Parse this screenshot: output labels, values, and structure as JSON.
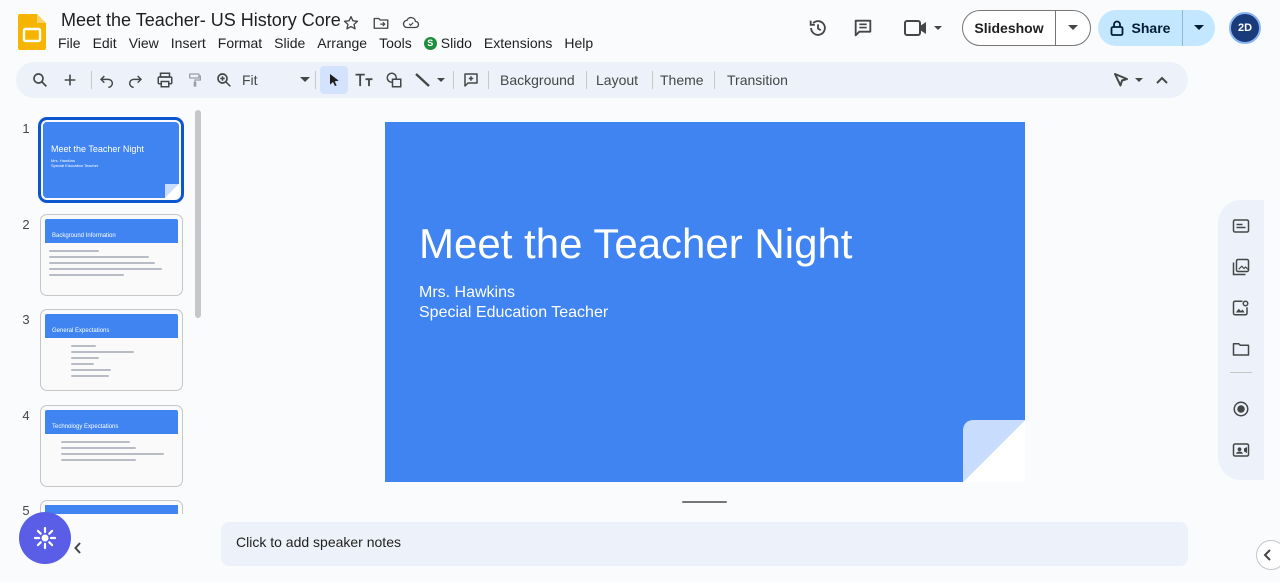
{
  "app": {
    "doc_title": "Meet the Teacher- US History Core"
  },
  "menu": [
    "File",
    "Edit",
    "View",
    "Insert",
    "Format",
    "Slide",
    "Arrange",
    "Tools",
    "Slido",
    "Extensions",
    "Help"
  ],
  "slido_badge": "S",
  "header": {
    "slideshow_label": "Slideshow",
    "share_label": "Share",
    "avatar_text": "2D"
  },
  "toolbar": {
    "zoom_label": "Fit",
    "background_label": "Background",
    "layout_label": "Layout",
    "theme_label": "Theme",
    "transition_label": "Transition"
  },
  "filmstrip": {
    "numbers": [
      "1",
      "2",
      "3",
      "4",
      "5"
    ],
    "slides": [
      {
        "title": "Meet the Teacher Night",
        "sub1": "Mrs. Hawkins",
        "sub2": "Special Education Teacher"
      },
      {
        "title": "Background Information"
      },
      {
        "title": "General Expectations"
      },
      {
        "title": "Technology Expectations"
      }
    ]
  },
  "slide": {
    "title": "Meet the Teacher Night",
    "subtitle_line1": "Mrs. Hawkins",
    "subtitle_line2": "Special Education Teacher"
  },
  "notes": {
    "placeholder": "Click to add speaker notes"
  },
  "colors": {
    "accent": "#0b57d0",
    "slide_bg": "#3f84f1",
    "share_bg": "#c2e7ff",
    "toolbar_bg": "#edf2fa"
  },
  "icons": [
    "star-icon",
    "move-to-folder-icon",
    "cloud-saved-icon",
    "history-icon",
    "comment-icon",
    "video-call-icon",
    "lock-icon",
    "search-icon",
    "plus-icon",
    "undo-icon",
    "redo-icon",
    "print-icon",
    "paint-format-icon",
    "zoom-icon",
    "cursor-icon",
    "text-box-icon",
    "shape-icon",
    "line-icon",
    "comment-add-icon",
    "pen-icon",
    "chevron-up-icon"
  ]
}
